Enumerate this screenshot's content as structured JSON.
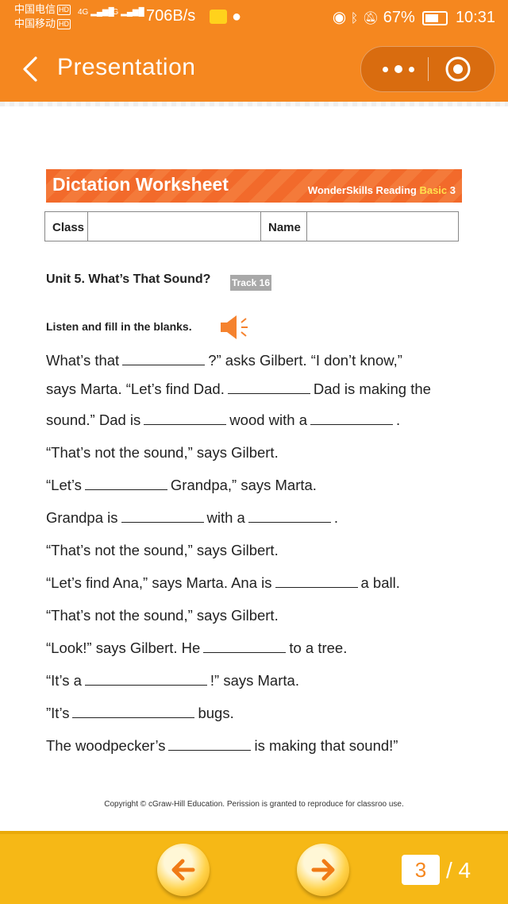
{
  "status_bar": {
    "carrier1": "中国电信",
    "carrier2": "中国移动",
    "hd": "HD",
    "net": "4G",
    "speed": "706B/s",
    "battery": "67%",
    "time": "10:31"
  },
  "app_bar": {
    "title": "Presentation"
  },
  "worksheet": {
    "title": "Dictation Worksheet",
    "brand_prefix": "WonderSkills Reading ",
    "brand_level": "Basic",
    "brand_num": " 3",
    "class_label": "Class",
    "name_label": "Name",
    "unit": "Unit 5. What’s That Sound?",
    "track": "Track 16",
    "instruction": "Listen and fill in the blanks.",
    "lines": [
      {
        "a": " What’s that",
        "b": "?” asks Gilbert. “I don’t know,”"
      },
      {
        "a": "says Marta. “Let’s find Dad.",
        "b": "Dad is making the"
      },
      {
        "a": "sound.” Dad is",
        "b": "wood with a",
        "c": "."
      },
      {
        "a": "“That’s not the sound,” says Gilbert."
      },
      {
        "a": "“Let’s",
        "b": "Grandpa,” says Marta."
      },
      {
        "a": "Grandpa is",
        "b": "with a",
        "c": "."
      },
      {
        "a": "“That’s not the sound,” says Gilbert."
      },
      {
        "a": "“Let’s find Ana,” says Marta. Ana is",
        "b": "a ball."
      },
      {
        "a": "“That’s not the sound,” says Gilbert."
      },
      {
        "a": "“Look!” says Gilbert. He",
        "b": "to a tree."
      },
      {
        "a": "“It’s a",
        "b": "!” says Marta."
      },
      {
        "a": "”It’s",
        "b": "bugs."
      },
      {
        "a": "The woodpecker’s",
        "b": "is making that sound!”"
      }
    ],
    "copyright": "Copyright © cGraw-Hill Education. Perission is granted to reproduce for classroo use."
  },
  "pager": {
    "current": "3",
    "total": "/ 4"
  }
}
